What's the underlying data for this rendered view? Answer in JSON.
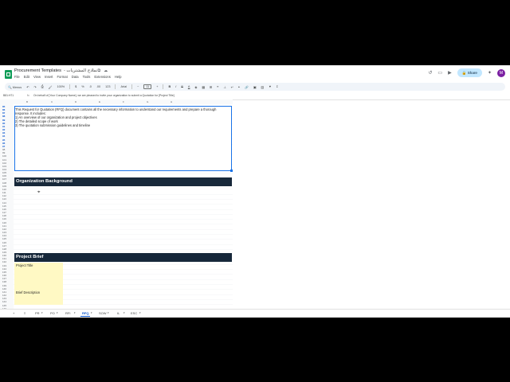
{
  "doc": {
    "title": "Procurement Templates",
    "title_suffix": "- نماذج المشتريات"
  },
  "menu": [
    "File",
    "Edit",
    "View",
    "Insert",
    "Format",
    "Data",
    "Tools",
    "Extensions",
    "Help"
  ],
  "header": {
    "share_label": "Share",
    "avatar_letter": "M"
  },
  "toolbar": {
    "menus_label": "Menus",
    "zoom": "100%",
    "currency": "$",
    "percent": "%",
    "dec_less": ".0",
    "dec_more": ".00",
    "format_123": "123",
    "font": "Arial",
    "font_size": "11",
    "bold": "B",
    "italic": "I",
    "strike": "S",
    "text_color": "A"
  },
  "formula_bar": {
    "name_box": "B81:H71",
    "fx": "fx",
    "formula": "On behalf of [Your Company Name], we are pleased to invite your organization to submit a Quotation for [Project Title]"
  },
  "columns": [
    "B",
    "C",
    "D",
    "E",
    "F",
    "G",
    "H"
  ],
  "rows": [
    "85",
    "86",
    "87",
    "88",
    "89",
    "90",
    "91",
    "92",
    "93",
    "94",
    "95",
    "96",
    "97",
    "98",
    "99",
    "100",
    "101",
    "102",
    "103",
    "104",
    "105",
    "106",
    "107",
    "108",
    "109",
    "110",
    "111",
    "112",
    "113",
    "114",
    "115",
    "116",
    "117",
    "118",
    "119",
    "120",
    "121",
    "122",
    "123",
    "124",
    "125",
    "126",
    "127",
    "128",
    "129",
    "130",
    "131",
    "132",
    "133",
    "134",
    "135",
    "136",
    "137",
    "138",
    "139",
    "140",
    "141",
    "142",
    "143",
    "144",
    "145",
    "146",
    "147"
  ],
  "intro_lines": [
    "This Request for Quotation (RFQ) document contains all the necessary information to understand our requirements and prepare a thorough",
    "response. It includes:",
    "1) An overview of our organization and project objectives",
    "2) The detailed scope of work",
    "3) The quotation submission guidelines and timeline"
  ],
  "sections": {
    "org": "Organization Background",
    "brief": "Project Brief"
  },
  "labels": {
    "project_title": "Project Title",
    "brief_description": "Brief Description"
  },
  "sheet_tabs": [
    "PR",
    "PO",
    "RFI",
    "RFQ",
    "SOW",
    "IL",
    "ESC"
  ],
  "active_tab": "RFQ"
}
